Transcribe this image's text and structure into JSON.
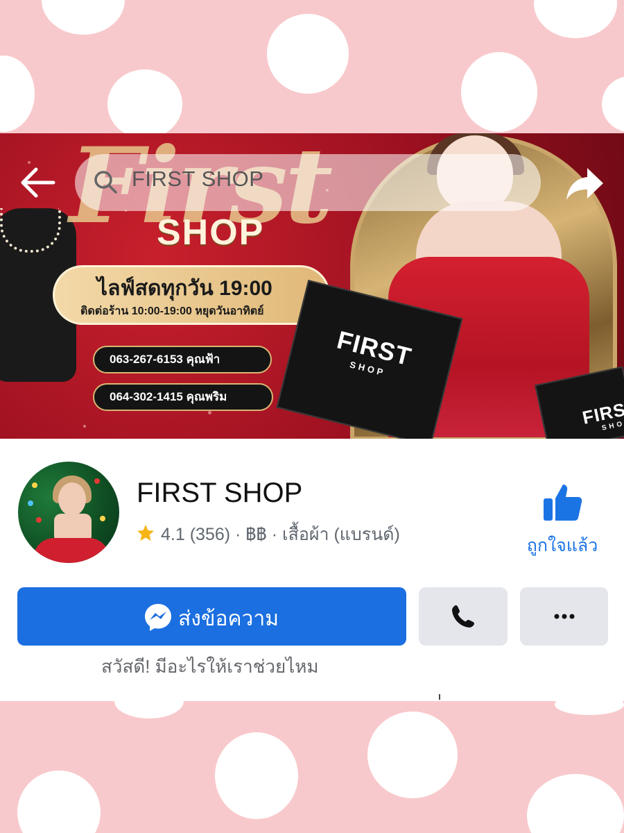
{
  "top_bar": {
    "search_text": "FIRST SHOP"
  },
  "banner": {
    "script_word": "First",
    "shop_word": "SHOP",
    "live_line": "ไลฟ์สดทุกวัน 19:00",
    "hours_line": "ติดต่อร้าน 10:00-19:00 หยุดวันอาทิตย์",
    "phones": [
      "063-267-6153 คุณฟ้า",
      "064-302-1415 คุณพริม"
    ],
    "bag_label": "FIRST",
    "bag_sub": "SHOP",
    "bag2_label": "FIRST",
    "bag2_sub": "SHOP"
  },
  "profile": {
    "name": "FIRST SHOP",
    "rating": "4.1",
    "meta_rest": "(356) · ฿฿ · เสื้อผ้า (แบรนด์)",
    "like_label": "ถูกใจแล้ว"
  },
  "actions": {
    "message_label": "ส่งข้อความ"
  },
  "greeting": "สวัสดี! มีอะไรให้เราช่วยไหม",
  "colors": {
    "background_pink": "#f8c9cc",
    "facebook_blue": "#1b6fe0",
    "like_blue": "#1b74e4",
    "grey_button": "#e4e6eb",
    "star": "#f5b516"
  },
  "icons": [
    "back-arrow-icon",
    "search-icon",
    "share-icon",
    "star-icon",
    "thumbs-up-icon",
    "messenger-icon",
    "phone-icon",
    "more-dots-icon"
  ]
}
